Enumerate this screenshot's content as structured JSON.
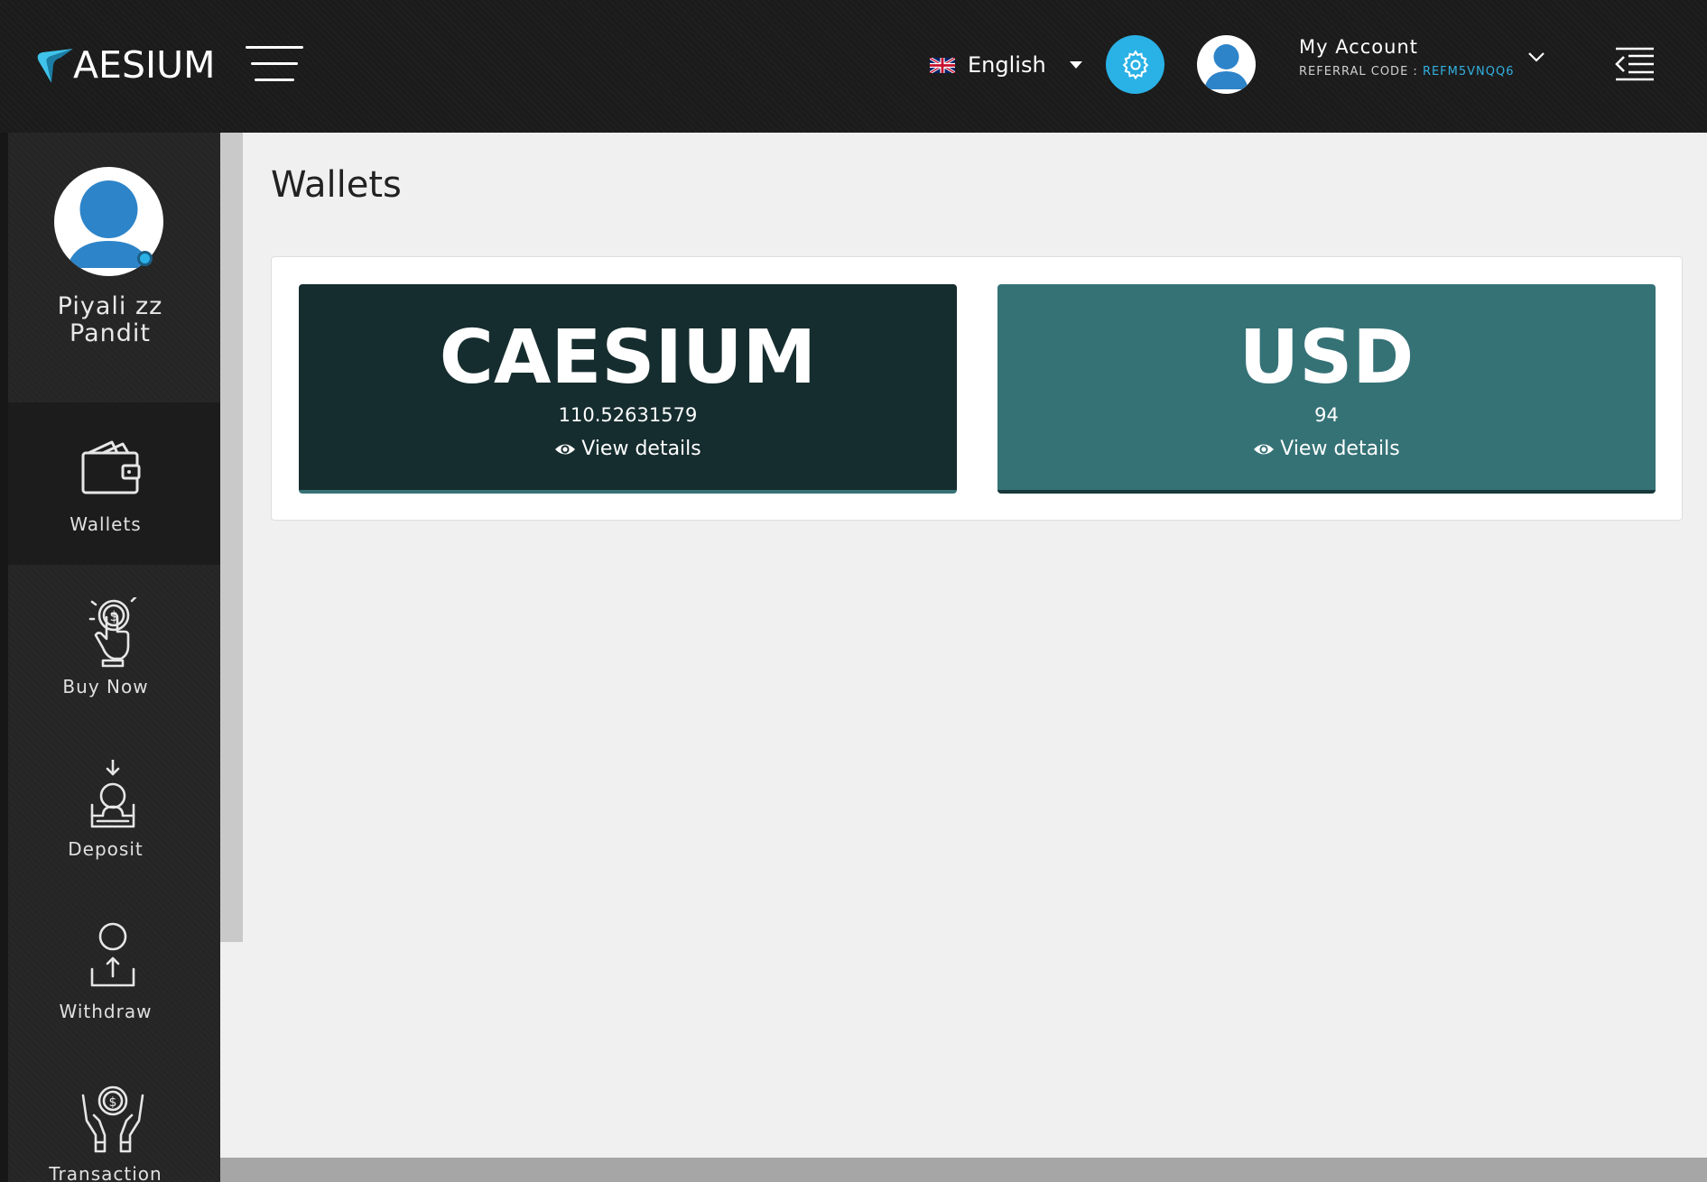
{
  "header": {
    "brand": "AESIUM",
    "language": "English",
    "account_title": "My Account",
    "referral_label": "REFERRAL CODE : ",
    "referral_code": "REFM5VNQQ6",
    "accent_color": "#2ab1e6"
  },
  "sidebar": {
    "user_name_line1": "Piyali zz",
    "user_name_line2": "Pandit",
    "items": [
      {
        "label": "Wallets",
        "icon": "wallet-icon",
        "active": true
      },
      {
        "label": "Buy Now",
        "icon": "buy-now-icon",
        "active": false
      },
      {
        "label": "Deposit",
        "icon": "deposit-icon",
        "active": false
      },
      {
        "label": "Withdraw",
        "icon": "withdraw-icon",
        "active": false
      },
      {
        "label": "Transaction",
        "icon": "transaction-icon",
        "active": false
      }
    ]
  },
  "main": {
    "title": "Wallets",
    "wallets": [
      {
        "name": "CAESIUM",
        "amount": "110.52631579",
        "link": "View details",
        "color": "#162d2f"
      },
      {
        "name": "USD",
        "amount": "94",
        "link": "View details",
        "color": "#357276"
      }
    ]
  }
}
